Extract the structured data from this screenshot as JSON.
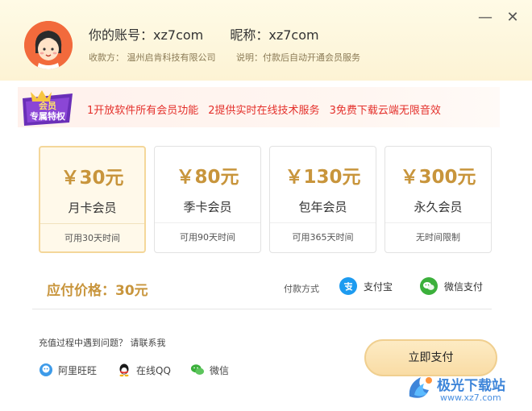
{
  "window": {
    "minimize_label": "—",
    "close_label": "✕"
  },
  "account": {
    "account_label": "你的账号：",
    "account_value": "xz7com",
    "nickname_label": "昵称：",
    "nickname_value": "xz7com",
    "payee": "收款方：  温州启肯科技有限公司",
    "note": "说明：付款后自动开通会员服务"
  },
  "banner": {
    "badge_text": [
      "会员",
      "专属特权"
    ],
    "items": [
      "1开放软件所有会员功能",
      "2提供实时在线技术服务",
      "3免费下载云端无限音效"
    ]
  },
  "plans": [
    {
      "price": "￥30元",
      "name": "月卡会员",
      "desc": "可用30天时间",
      "selected": true
    },
    {
      "price": "￥80元",
      "name": "季卡会员",
      "desc": "可用90天时间",
      "selected": false
    },
    {
      "price": "￥130元",
      "name": "包年会员",
      "desc": "可用365天时间",
      "selected": false
    },
    {
      "price": "￥300元",
      "name": "永久会员",
      "desc": "无时间限制",
      "selected": false
    }
  ],
  "payment": {
    "amount_label": "应付价格：",
    "amount_value": "30元",
    "method_label": "付款方式",
    "alipay_label": "支付宝",
    "wechat_label": "微信支付"
  },
  "help": {
    "text": "充值过程中遇到问题？ 请联系我",
    "aliwangwang": "阿里旺旺",
    "qq": "在线QQ",
    "wechat": "微信"
  },
  "pay_button": "立即支付",
  "watermark": {
    "title": "极光下载站",
    "url": "www.xz7.com"
  },
  "colors": {
    "accent_gold": "#c8953c",
    "banner_red": "#e4302b",
    "alipay_blue": "#1d9bf0",
    "wechat_green": "#3bb03b"
  }
}
